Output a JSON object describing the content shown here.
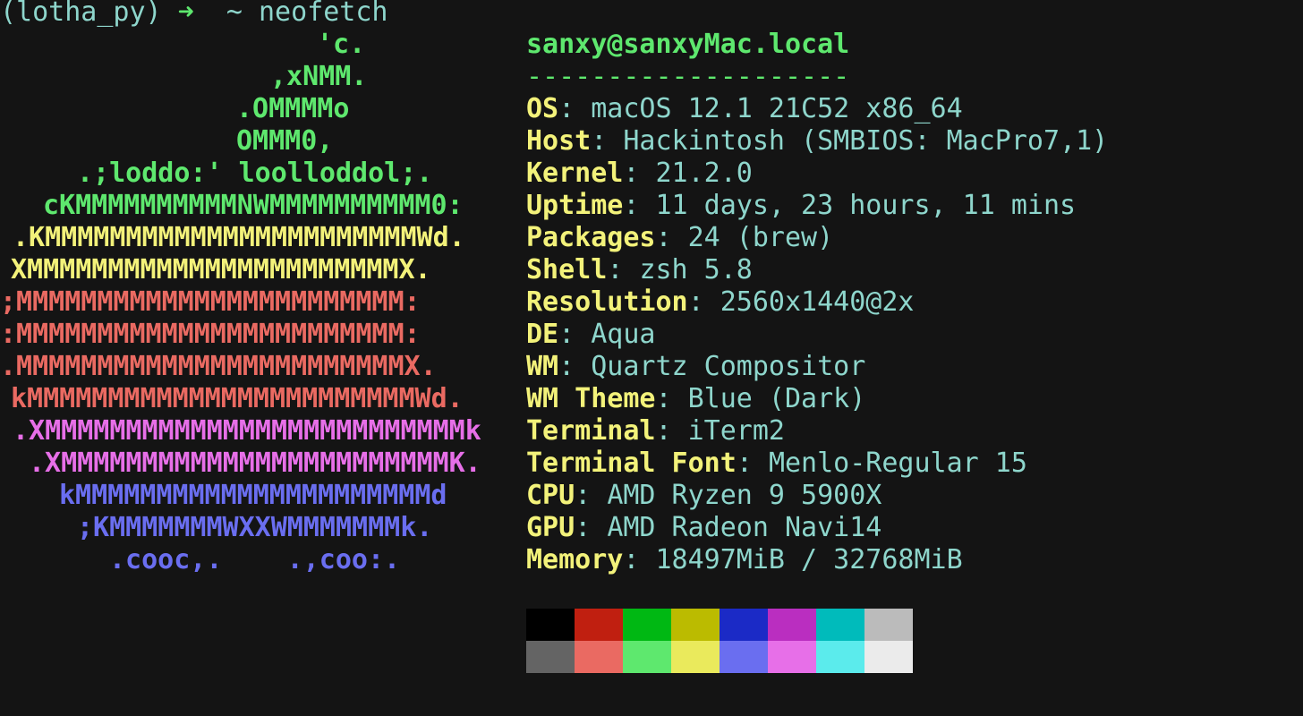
{
  "prompt": {
    "env": "(lotha_py)",
    "arrow": "➜",
    "dir": "~",
    "command": "neofetch"
  },
  "logo": [
    {
      "text": "'c.",
      "color": "green"
    },
    {
      "text": ",xNMM.",
      "color": "green"
    },
    {
      "text": ".OMMMMo",
      "color": "green"
    },
    {
      "text": "OMMM0,",
      "color": "green"
    },
    {
      "text": ".;loddo:' loolloddol;.",
      "color": "green"
    },
    {
      "text": "cKMMMMMMMMMMNWMMMMMMMMMM0:",
      "color": "green"
    },
    {
      "text": ".KMMMMMMMMMMMMMMMMMMMMMMMWd.",
      "color": "yellow"
    },
    {
      "text": "XMMMMMMMMMMMMMMMMMMMMMMMX.",
      "color": "yellow"
    },
    {
      "text": ";MMMMMMMMMMMMMMMMMMMMMMMM:",
      "color": "red"
    },
    {
      "text": ":MMMMMMMMMMMMMMMMMMMMMMMM:",
      "color": "red"
    },
    {
      "text": ".MMMMMMMMMMMMMMMMMMMMMMMMX.",
      "color": "red"
    },
    {
      "text": "kMMMMMMMMMMMMMMMMMMMMMMMMWd.",
      "color": "red"
    },
    {
      "text": ".XMMMMMMMMMMMMMMMMMMMMMMMMMMk",
      "color": "magenta"
    },
    {
      "text": ".XMMMMMMMMMMMMMMMMMMMMMMMMK.",
      "color": "magenta"
    },
    {
      "text": "kMMMMMMMMMMMMMMMMMMMMMMd",
      "color": "blue"
    },
    {
      "text": ";KMMMMMMMWXXWMMMMMMMk.",
      "color": "blue"
    },
    {
      "text": ".cooc,.    .,coo:.",
      "color": "blue"
    }
  ],
  "info": {
    "user_host": "sanxy@sanxyMac.local",
    "separator": "--------------------",
    "fields": [
      {
        "key": "OS",
        "value": "macOS 12.1 21C52 x86_64"
      },
      {
        "key": "Host",
        "value": "Hackintosh (SMBIOS: MacPro7,1)"
      },
      {
        "key": "Kernel",
        "value": "21.2.0"
      },
      {
        "key": "Uptime",
        "value": "11 days, 23 hours, 11 mins"
      },
      {
        "key": "Packages",
        "value": "24 (brew)"
      },
      {
        "key": "Shell",
        "value": "zsh 5.8"
      },
      {
        "key": "Resolution",
        "value": "2560x1440@2x"
      },
      {
        "key": "DE",
        "value": "Aqua"
      },
      {
        "key": "WM",
        "value": "Quartz Compositor"
      },
      {
        "key": "WM Theme",
        "value": "Blue (Dark)"
      },
      {
        "key": "Terminal",
        "value": "iTerm2"
      },
      {
        "key": "Terminal Font",
        "value": "Menlo-Regular 15"
      },
      {
        "key": "CPU",
        "value": "AMD Ryzen 9 5900X"
      },
      {
        "key": "GPU",
        "value": "AMD Radeon Navi14"
      },
      {
        "key": "Memory",
        "value": "18497MiB / 32768MiB"
      }
    ]
  },
  "colors": {
    "background": "#141414",
    "palette_normal": [
      "#000000",
      "#c01f10",
      "#00b813",
      "#bbbb00",
      "#1b2ac6",
      "#ba2ec0",
      "#00bbbb",
      "#bbbbbb"
    ],
    "palette_bright": [
      "#646464",
      "#ea6a62",
      "#5ee86e",
      "#eaea5c",
      "#6a6ef0",
      "#e76fe8",
      "#5bebec",
      "#ebebeb"
    ]
  }
}
